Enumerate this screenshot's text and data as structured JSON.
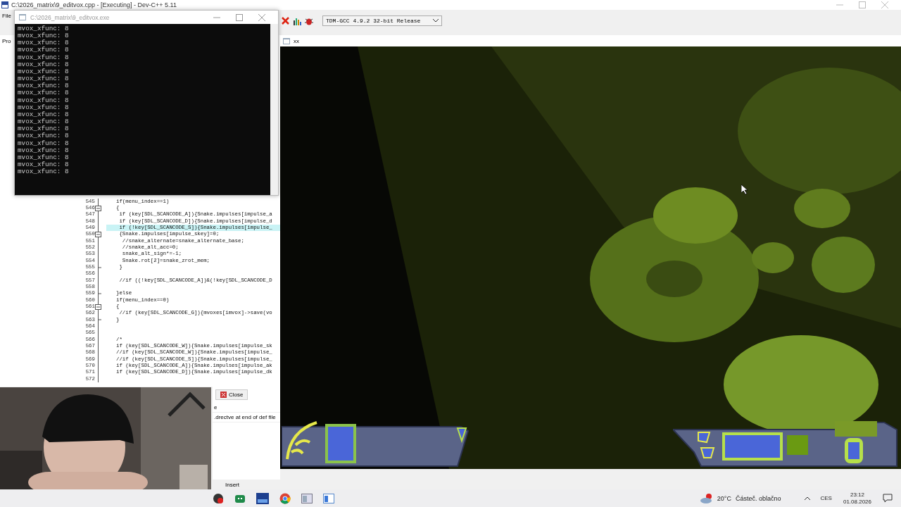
{
  "ide": {
    "title": "C:\\2026_matrix\\9_editvox.cpp - [Executing] - Dev-C++ 5.11",
    "menu": [
      "File"
    ],
    "compiler": "TDM-GCC 4.9.2 32-bit Release",
    "panel_tab": "Pro",
    "code_lines": [
      {
        "number": "545",
        "text": "if(menu_index==1)",
        "fold_box": false,
        "fold_end": false,
        "highlighted": false
      },
      {
        "number": "546",
        "text": "{",
        "fold_box": true,
        "fold_end": false,
        "highlighted": false
      },
      {
        "number": "547",
        "text": " if (key[SDL_SCANCODE_A]){Snake.impulses[impulse_a",
        "fold_box": false,
        "fold_end": false,
        "highlighted": false
      },
      {
        "number": "548",
        "text": " if (key[SDL_SCANCODE_D]){Snake.impulses[impulse_d",
        "fold_box": false,
        "fold_end": false,
        "highlighted": false
      },
      {
        "number": "549",
        "text": " if (!key[SDL_SCANCODE_S]){Snake.impulses[impulse_",
        "fold_box": false,
        "fold_end": false,
        "highlighted": true
      },
      {
        "number": "550",
        "text": " {Snake.impulses[impulse_skey]=0;",
        "fold_box": true,
        "fold_end": false,
        "highlighted": false
      },
      {
        "number": "551",
        "text": "  //snake_alternate=snake_alternate_base;",
        "fold_box": false,
        "fold_end": false,
        "highlighted": false
      },
      {
        "number": "552",
        "text": "  //snake_alt_acc=0;",
        "fold_box": false,
        "fold_end": false,
        "highlighted": false
      },
      {
        "number": "553",
        "text": "  snake_alt_sign*=-1;",
        "fold_box": false,
        "fold_end": false,
        "highlighted": false
      },
      {
        "number": "554",
        "text": "  Snake.rot[2]=snake_zrot_mem;",
        "fold_box": false,
        "fold_end": false,
        "highlighted": false
      },
      {
        "number": "555",
        "text": " }",
        "fold_box": false,
        "fold_end": true,
        "highlighted": false
      },
      {
        "number": "556",
        "fold_box": false,
        "fold_end": false,
        "highlighted": false
      },
      {
        "number": "557",
        "text": " //if ((!key[SDL_SCANCODE_A])&(!key[SDL_SCANCODE_D",
        "fold_box": false,
        "fold_end": false,
        "highlighted": false
      },
      {
        "number": "558",
        "fold_box": false,
        "fold_end": false,
        "highlighted": false
      },
      {
        "number": "559",
        "text": "}else",
        "fold_box": false,
        "fold_end": true,
        "highlighted": false
      },
      {
        "number": "560",
        "text": "if(menu_index==0)",
        "fold_box": false,
        "fold_end": false,
        "highlighted": false
      },
      {
        "number": "561",
        "text": "{",
        "fold_box": true,
        "fold_end": false,
        "highlighted": false
      },
      {
        "number": "562",
        "text": " //if (key[SDL_SCANCODE_G]){mvoxes[imvox]->save(vo",
        "fold_box": false,
        "fold_end": false,
        "highlighted": false
      },
      {
        "number": "563",
        "text": "}",
        "fold_box": false,
        "fold_end": true,
        "highlighted": false
      },
      {
        "number": "564",
        "fold_box": false,
        "fold_end": false,
        "highlighted": false
      },
      {
        "number": "565",
        "fold_box": false,
        "fold_end": false,
        "highlighted": false
      },
      {
        "number": "566",
        "text": "/*",
        "fold_box": false,
        "fold_end": false,
        "highlighted": false
      },
      {
        "number": "567",
        "text": "if (key[SDL_SCANCODE_W]){Snake.impulses[impulse_sk",
        "fold_box": false,
        "fold_end": false,
        "highlighted": false
      },
      {
        "number": "568",
        "text": "//if (key[SDL_SCANCODE_W]){Snake.impulses[impulse_",
        "fold_box": false,
        "fold_end": false,
        "highlighted": false
      },
      {
        "number": "569",
        "text": "//if (key[SDL_SCANCODE_S]){Snake.impulses[impulse_",
        "fold_box": false,
        "fold_end": false,
        "highlighted": false
      },
      {
        "number": "570",
        "text": "if (key[SDL_SCANCODE_A]){Snake.impulses[impulse_ak",
        "fold_box": false,
        "fold_end": false,
        "highlighted": false
      },
      {
        "number": "571",
        "text": "if (key[SDL_SCANCODE_D]){Snake.impulses[impulse_dk",
        "fold_box": false,
        "fold_end": false,
        "highlighted": false
      },
      {
        "number": "572",
        "fold_box": false,
        "fold_end": false,
        "highlighted": false
      }
    ],
    "messages": {
      "close_button": "Close",
      "lines": [
        "e",
        ".drectve at end of def file"
      ]
    },
    "status": "Insert"
  },
  "console": {
    "title": "C:\\2026_matrix\\9_editvox.exe",
    "lines": [
      "mvox_xfunc: 8",
      "mvox_xfunc: 8",
      "mvox_xfunc: 8",
      "mvox_xfunc: 8",
      "mvox_xfunc: 8",
      "mvox_xfunc: 8",
      "mvox_xfunc: 8",
      "mvox_xfunc: 8",
      "mvox_xfunc: 8",
      "mvox_xfunc: 8",
      "mvox_xfunc: 8",
      "mvox_xfunc: 8",
      "mvox_xfunc: 8",
      "mvox_xfunc: 8",
      "mvox_xfunc: 8",
      "mvox_xfunc: 8",
      "mvox_xfunc: 8",
      "mvox_xfunc: 8",
      "mvox_xfunc: 8",
      "mvox_xfunc: 8",
      "mvox_xfunc: 8"
    ]
  },
  "game": {
    "title": "xx"
  },
  "taskbar": {
    "temperature": "20°C",
    "weather": "Částeč. oblačno",
    "language": "CES",
    "time": "23:12",
    "date": "01.08.2026"
  }
}
